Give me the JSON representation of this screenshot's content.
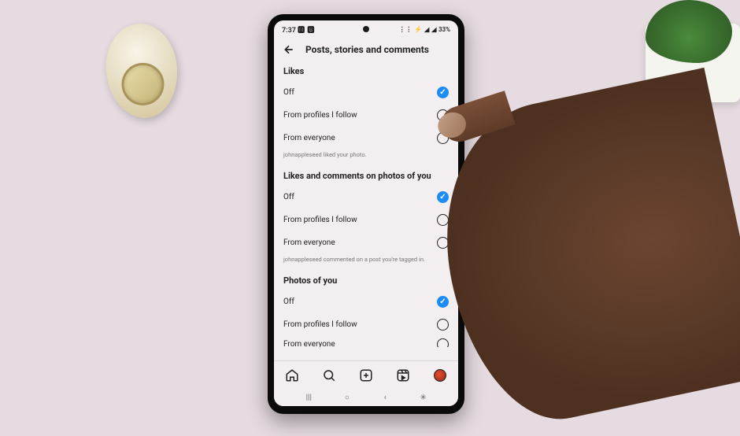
{
  "status_bar": {
    "time": "7:37",
    "left_icons": "🅼 🅱",
    "right_icons": "⋮⋮ ⚡ ◢ ◢",
    "battery": "33%"
  },
  "header": {
    "title": "Posts, stories and comments"
  },
  "sections": [
    {
      "title": "Likes",
      "options": [
        {
          "label": "Off",
          "selected": true
        },
        {
          "label": "From profiles I follow",
          "selected": false
        },
        {
          "label": "From everyone",
          "selected": false
        }
      ],
      "example": "johnappleseed liked your photo."
    },
    {
      "title": "Likes and comments on photos of you",
      "options": [
        {
          "label": "Off",
          "selected": true
        },
        {
          "label": "From profiles I follow",
          "selected": false
        },
        {
          "label": "From everyone",
          "selected": false
        }
      ],
      "example": "johnappleseed commented on a post you're tagged in."
    },
    {
      "title": "Photos of you",
      "options": [
        {
          "label": "Off",
          "selected": true
        },
        {
          "label": "From profiles I follow",
          "selected": false
        },
        {
          "label": "From everyone",
          "selected": false
        }
      ],
      "example": ""
    }
  ],
  "soft_keys": {
    "recent": "|||",
    "home": "○",
    "back": "‹",
    "accessibility": "✳"
  }
}
